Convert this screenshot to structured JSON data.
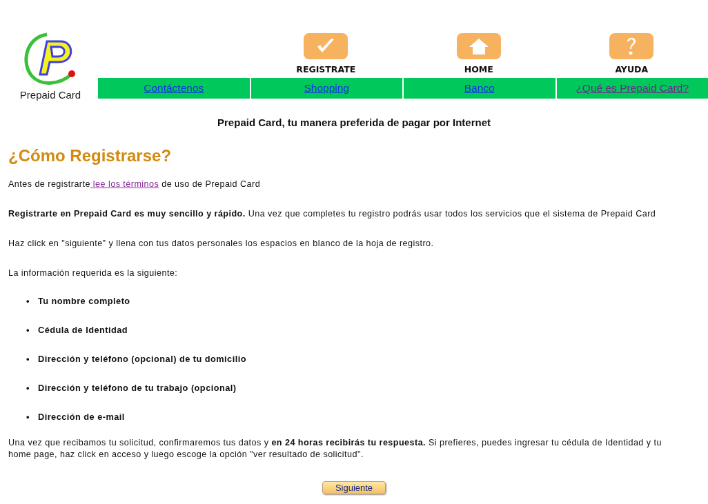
{
  "logo": {
    "text": "Prepaid Card"
  },
  "top_links": [
    {
      "label": "REGISTRATE"
    },
    {
      "label": "HOME"
    },
    {
      "label": "AYUDA"
    }
  ],
  "nav": [
    {
      "label": "Contáctenos",
      "visited": false
    },
    {
      "label": "Shopping",
      "visited": false
    },
    {
      "label": "Banco",
      "visited": false
    },
    {
      "label": "¿Qué es Prepaid Card?",
      "visited": true
    }
  ],
  "tagline": "Prepaid Card, tu manera preferida de pagar por Internet",
  "heading": "¿Cómo Registrarse?",
  "intro": {
    "before": "Antes de registrarte",
    "link": "lee los términos",
    "link_visited": true,
    "after": "de uso de Prepaid Card"
  },
  "paragraphs": [
    "**Registrarte en Prepaid Card es muy sencillo y rápido.** Una vez que completes tu registro podrás usar todos los servicios que el sistema de Prepaid Card",
    "Haz click en \"siguiente\" y llena con tus datos personales los espacios en blanco de la hoja de registro.",
    "La información requerida es la siguiente:"
  ],
  "requirements": [
    {
      "bullet": "•",
      "text": "Tu nombre completo"
    },
    {
      "bullet": "•",
      "text": "Cédula de Identidad"
    },
    {
      "bullet": "•",
      "text": "Dirección y teléfono (opcional) de tu domicilio"
    },
    {
      "bullet": "•",
      "text": "Dirección y teléfono de tu trabajo (opcional)"
    },
    {
      "bullet": "•",
      "text": "Dirección de e-mail"
    }
  ],
  "closing_lines": [
    "Una vez que recibamos tu solicitud, confirmaremos tus datos y **en 24 horas recibirás tu respuesta.** Si prefieres, puedes ingresar tu cédula de Identidad y tu",
    "home page, haz click en acceso y luego escoge la opción \"ver resultado de solicitud\"."
  ],
  "next_button": "Siguiente"
}
